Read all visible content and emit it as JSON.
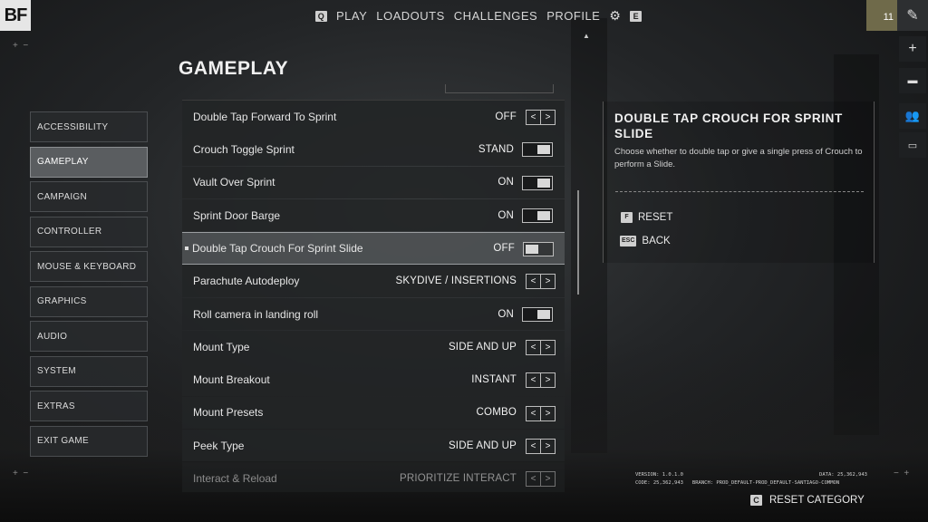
{
  "brand": {
    "logo": "BF"
  },
  "nav": {
    "left_key": "Q",
    "items": [
      "PLAY",
      "LOADOUTS",
      "CHALLENGES",
      "PROFILE"
    ],
    "right_key": "E",
    "settings_icon": "gear-icon"
  },
  "player": {
    "rank": "11"
  },
  "page": {
    "title": "GAMEPLAY"
  },
  "menu": {
    "active": "GAMEPLAY",
    "items": [
      "ACCESSIBILITY",
      "GAMEPLAY",
      "CAMPAIGN",
      "CONTROLLER",
      "MOUSE & KEYBOARD",
      "GRAPHICS",
      "AUDIO",
      "SYSTEM",
      "EXTRAS",
      "EXIT GAME"
    ]
  },
  "settings": [
    {
      "label": "Double Tap Forward To Sprint",
      "value": "OFF",
      "control": "arrows"
    },
    {
      "label": "Crouch Toggle Sprint",
      "value": "STAND",
      "control": "switch",
      "state": "on"
    },
    {
      "label": "Vault Over Sprint",
      "value": "ON",
      "control": "switch",
      "state": "on"
    },
    {
      "label": "Sprint Door Barge",
      "value": "ON",
      "control": "switch",
      "state": "on"
    },
    {
      "label": "Double Tap Crouch For Sprint Slide",
      "value": "OFF",
      "control": "switch",
      "state": "off",
      "selected": true
    },
    {
      "label": "Parachute Autodeploy",
      "value": "SKYDIVE / INSERTIONS",
      "control": "arrows"
    },
    {
      "label": "Roll camera in landing roll",
      "value": "ON",
      "control": "switch",
      "state": "on"
    },
    {
      "label": "Mount Type",
      "value": "SIDE AND UP",
      "control": "arrows"
    },
    {
      "label": "Mount Breakout",
      "value": "INSTANT",
      "control": "arrows"
    },
    {
      "label": "Mount Presets",
      "value": "COMBO",
      "control": "arrows"
    },
    {
      "label": "Peek Type",
      "value": "SIDE AND UP",
      "control": "arrows"
    },
    {
      "label": "Interact & Reload",
      "value": "PRIORITIZE INTERACT",
      "control": "arrows",
      "dim": true
    }
  ],
  "info": {
    "title": "DOUBLE TAP CROUCH FOR SPRINT SLIDE",
    "description": "Choose whether to double tap or give a single press of Crouch to perform a Slide.",
    "reset_key": "F",
    "reset_label": "RESET",
    "back_key": "ESC",
    "back_label": "BACK"
  },
  "footer": {
    "version": "VERSION: 1.0.1.0",
    "data": "DATA: 25,362,943",
    "code": "CODE: 25,362,943",
    "branch": "BRANCH: PROD_DEFAULT-PROD_DEFAULT-SANTIAGO-COMMON",
    "reset_category_key": "C",
    "reset_category_label": "RESET CATEGORY"
  }
}
